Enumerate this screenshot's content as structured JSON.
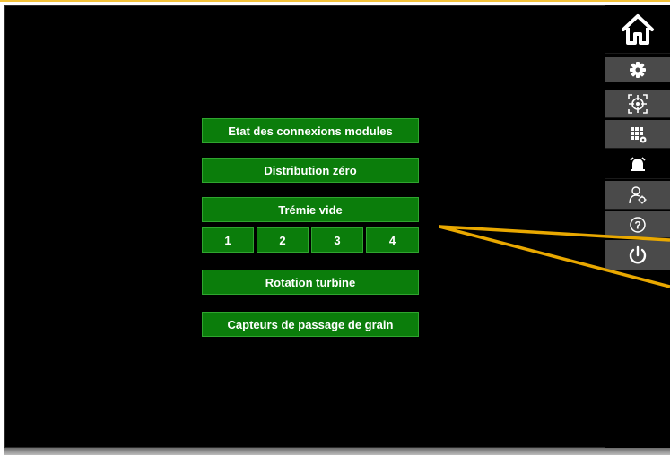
{
  "menu": {
    "items": [
      {
        "label": "Etat des connexions modules"
      },
      {
        "label": "Distribution zéro"
      },
      {
        "label": "Trémie vide"
      },
      {
        "label": "Rotation turbine"
      },
      {
        "label": "Capteurs de passage de grain"
      }
    ],
    "hopper_buttons": [
      "1",
      "2",
      "3",
      "4"
    ]
  },
  "sidebar": {
    "icons": [
      "home-icon",
      "gear-icon",
      "target-calibration-icon",
      "grid-settings-icon",
      "alarm-bell-icon",
      "user-settings-icon",
      "help-icon",
      "power-icon"
    ]
  },
  "colors": {
    "button_green": "#0b7d0b",
    "button_border": "#2fa52f",
    "callout": "#e9a800",
    "sidebar_button": "#4a4a4a"
  }
}
